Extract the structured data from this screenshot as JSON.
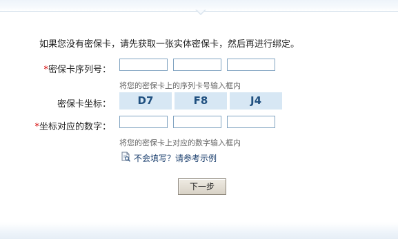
{
  "intro_text": "如果您没有密保卡，请先获取一张实体密保卡，然后再进行绑定。",
  "serial": {
    "required_mark": "*",
    "label": "密保卡序列号：",
    "inputs": [
      "",
      "",
      ""
    ],
    "hint": "将您的密保卡上的序列卡号输入框内"
  },
  "coords": {
    "label": "密保卡坐标：",
    "values": [
      "D7",
      "F8",
      "J4"
    ]
  },
  "digits": {
    "required_mark": "*",
    "label": "坐标对应的数字：",
    "inputs": [
      "",
      "",
      ""
    ],
    "hint": "将您的密保卡上对应的数字输入框内"
  },
  "help_link": {
    "icon": "document-search-icon",
    "label": "不会填写？请参考示例"
  },
  "next_button": "下一步",
  "colors": {
    "required": "#d40000",
    "input_border": "#7fa2c0",
    "coord_bg": "#d7e7f4",
    "coord_text": "#1f4f7f",
    "link": "#1b3f6e"
  }
}
